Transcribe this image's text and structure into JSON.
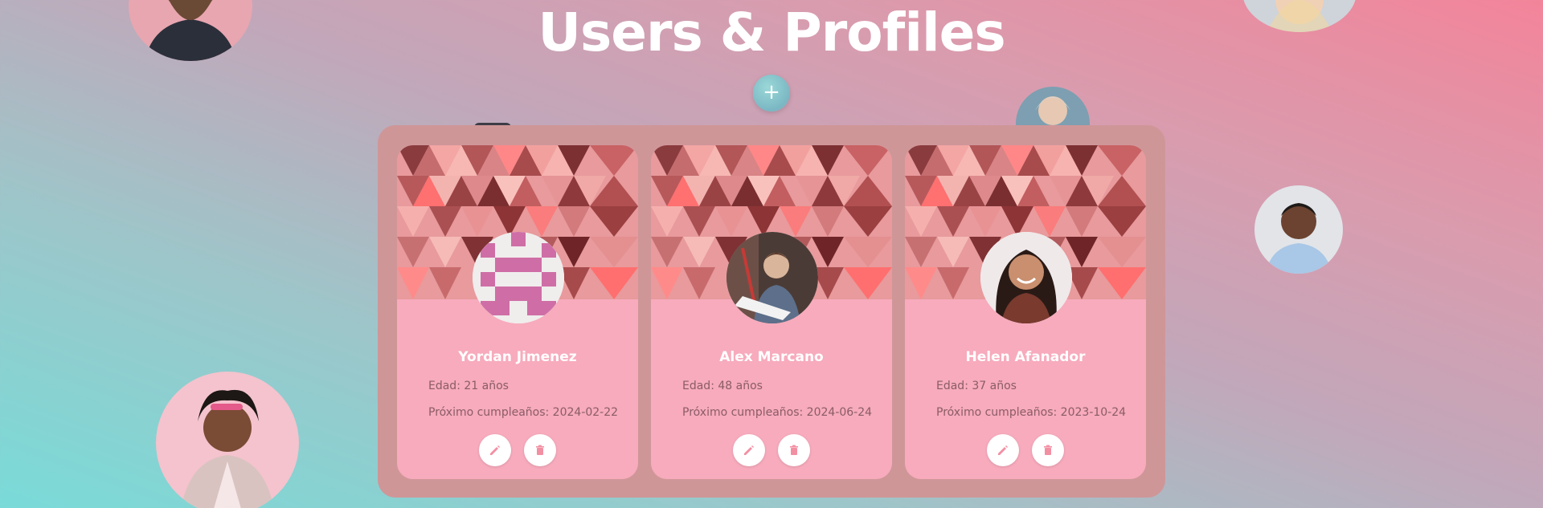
{
  "page": {
    "title": "Users & Profiles",
    "add_label": "+"
  },
  "cards": [
    {
      "name": "Yordan Jimenez",
      "age": "Edad: 21 años",
      "birthday": "Próximo cumpleaños: 2024-02-22",
      "avatar": "identicon-avatar"
    },
    {
      "name": "Alex Marcano",
      "age": "Edad: 48 años",
      "birthday": "Próximo cumpleaños: 2024-06-24",
      "avatar": "man-photo-avatar"
    },
    {
      "name": "Helen Afanador",
      "age": "Edad: 37 años",
      "birthday": "Próximo cumpleaños: 2023-10-24",
      "avatar": "woman-photo-avatar"
    }
  ],
  "icons": {
    "edit": "pencil-icon",
    "delete": "trash-icon",
    "add": "plus-icon"
  },
  "colors": {
    "accent": "#f7abbc",
    "panel": "#cf9698",
    "icon": "#f38fa3"
  }
}
